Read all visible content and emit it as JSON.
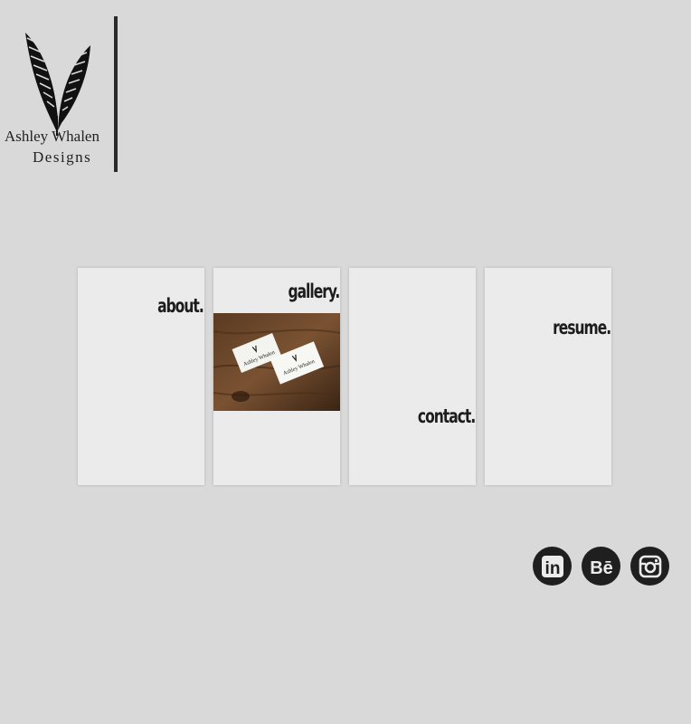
{
  "logo": {
    "name": "Ashley Whalen",
    "subtitle": "Designs",
    "icon": "feather-icon"
  },
  "nav": {
    "about": "about.",
    "gallery": "gallery.",
    "contact": "contact.",
    "resume": "resume."
  },
  "gallery_preview": {
    "card_text": "Ashley Whalen"
  },
  "social": {
    "linkedin_text": "in",
    "behance_text": "Bē",
    "icons": [
      "linkedin-icon",
      "behance-icon",
      "instagram-icon"
    ]
  },
  "colors": {
    "background": "#d9d9d9",
    "card": "#ebebeb",
    "text": "#1d1d1d"
  }
}
